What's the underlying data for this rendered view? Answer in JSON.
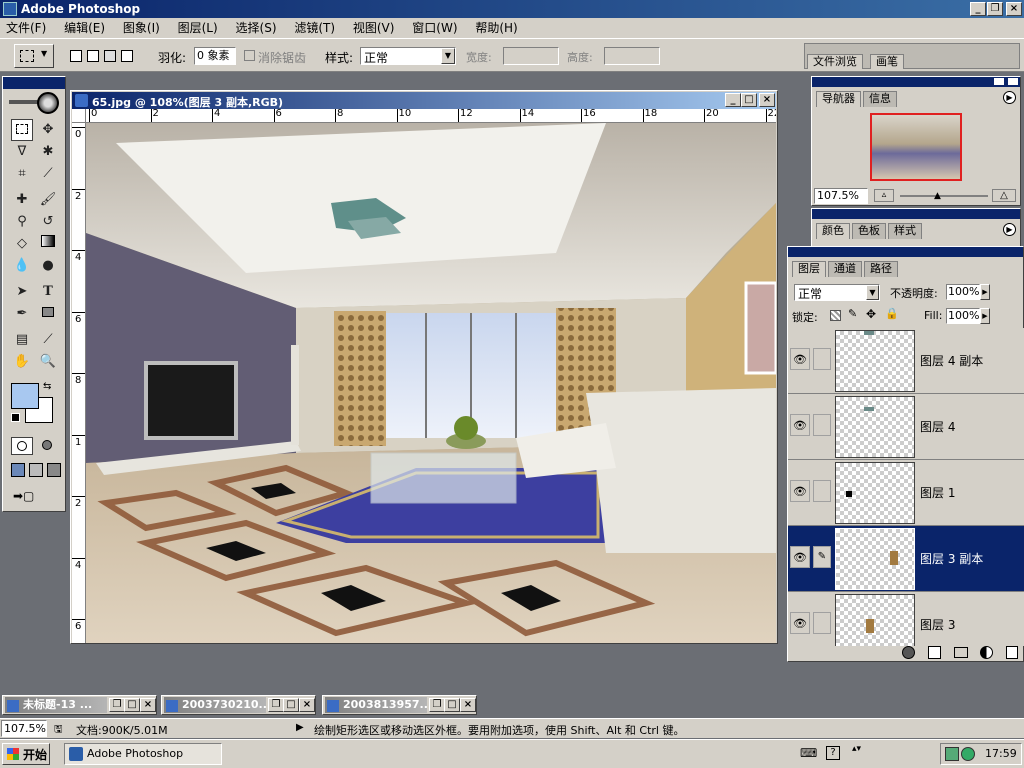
{
  "app": {
    "title": "Adobe Photoshop"
  },
  "menu": [
    "文件(F)",
    "编辑(E)",
    "图象(I)",
    "图层(L)",
    "选择(S)",
    "滤镜(T)",
    "视图(V)",
    "窗口(W)",
    "帮助(H)"
  ],
  "options": {
    "feather_label": "羽化:",
    "feather_value": "0 象素",
    "antialias_label": "消除锯齿",
    "style_label": "样式:",
    "style_value": "正常",
    "width_label": "宽度:",
    "height_label": "高度:",
    "tab_browser": "文件浏览",
    "tab_brushes": "画笔"
  },
  "document": {
    "title": "65.jpg @ 108%(图层 3 副本,RGB)",
    "ruler_h": [
      "0",
      "2",
      "4",
      "6",
      "8",
      "10",
      "12",
      "14",
      "16",
      "18",
      "20",
      "22"
    ],
    "ruler_v": [
      "0",
      "2",
      "4",
      "6",
      "8",
      "1",
      "2",
      "4",
      "6"
    ]
  },
  "navigator": {
    "tabs": [
      "导航器",
      "信息"
    ],
    "zoom": "107.5%"
  },
  "color_palette": {
    "tabs": [
      "颜色",
      "色板",
      "样式"
    ]
  },
  "layers": {
    "tabs": [
      "图层",
      "通道",
      "路径"
    ],
    "blend_mode": "正常",
    "opacity_label": "不透明度:",
    "opacity_value": "100%",
    "lock_label": "锁定:",
    "fill_label": "Fill:",
    "fill_value": "100%",
    "items": [
      {
        "name": "图层 4 副本",
        "selected": false
      },
      {
        "name": "图层 4",
        "selected": false
      },
      {
        "name": "图层 1",
        "selected": false
      },
      {
        "name": "图层 3 副本",
        "selected": true
      },
      {
        "name": "图层 3",
        "selected": false
      }
    ]
  },
  "minimized_windows": [
    "未标题-13 ...",
    "2003730210...",
    "2003813957..."
  ],
  "status": {
    "zoom": "107.5%",
    "doc": "文档:900K/5.01M",
    "hint": "绘制矩形选区或移动选区外框。要用附加选项，使用 Shift、Alt 和 Ctrl 键。"
  },
  "taskbar": {
    "start": "开始",
    "task": "Adobe Photoshop",
    "clock": "17:59"
  },
  "colors": {
    "foreground": "#a8c8f0",
    "background": "#ffffff",
    "selection": "#0a246a"
  }
}
